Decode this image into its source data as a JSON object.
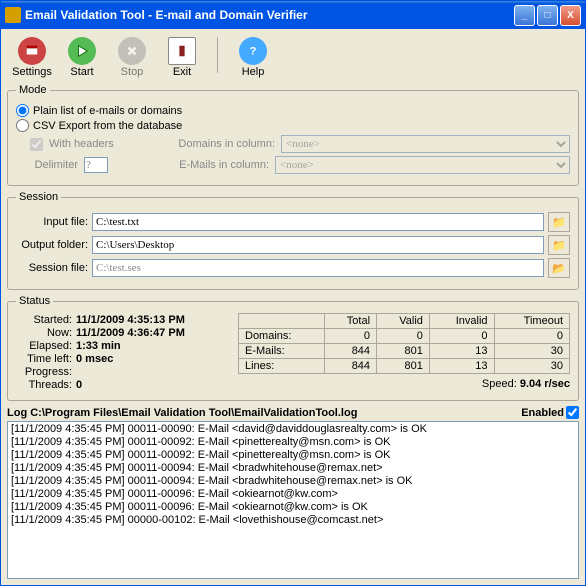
{
  "title": "Email Validation Tool - E-mail and Domain Verifier",
  "toolbar": {
    "settings": "Settings",
    "start": "Start",
    "stop": "Stop",
    "exit": "Exit",
    "help": "Help"
  },
  "mode": {
    "legend": "Mode",
    "opt_plain": "Plain list of e-mails or domains",
    "opt_csv": "CSV Export from the database",
    "with_headers": "With headers",
    "delimiter_lbl": "Delimiter",
    "delimiter_val": "?",
    "dom_col_lbl": "Domains in column:",
    "email_col_lbl": "E-Mails in column:",
    "none": "<none>"
  },
  "session": {
    "legend": "Session",
    "input_lbl": "Input file:",
    "input_val": "C:\\test.txt",
    "output_lbl": "Output folder:",
    "output_val": "C:\\Users\\Desktop",
    "sess_lbl": "Session file:",
    "sess_val": "C:\\test.ses"
  },
  "status": {
    "legend": "Status",
    "started_lbl": "Started:",
    "started_val": "11/1/2009 4:35:13 PM",
    "now_lbl": "Now:",
    "now_val": "11/1/2009 4:36:47 PM",
    "elapsed_lbl": "Elapsed:",
    "elapsed_val": "1:33 min",
    "timeleft_lbl": "Time left:",
    "timeleft_val": "0 msec",
    "progress_lbl": "Progress:",
    "progress_val": "",
    "threads_lbl": "Threads:",
    "threads_val": "0",
    "hdr_total": "Total",
    "hdr_valid": "Valid",
    "hdr_invalid": "Invalid",
    "hdr_timeout": "Timeout",
    "row_domains": "Domains:",
    "row_emails": "E-Mails:",
    "row_lines": "Lines:",
    "d_total": "0",
    "d_valid": "0",
    "d_invalid": "0",
    "d_timeout": "0",
    "e_total": "844",
    "e_valid": "801",
    "e_invalid": "13",
    "e_timeout": "30",
    "l_total": "844",
    "l_valid": "801",
    "l_invalid": "13",
    "l_timeout": "30",
    "speed_lbl": "Speed:",
    "speed_val": "9.04 r/sec"
  },
  "log": {
    "header": "Log C:\\Program Files\\Email Validation Tool\\EmailValidationTool.log",
    "enabled": "Enabled",
    "lines": [
      "[11/1/2009 4:35:45 PM] 00011-00090: E-Mail <david@daviddouglasrealty.com> is OK",
      "[11/1/2009 4:35:45 PM] 00011-00092: E-Mail <pinetterealty@msn.com> is OK",
      "[11/1/2009 4:35:45 PM] 00011-00092: E-Mail <pinetterealty@msn.com> is OK",
      "[11/1/2009 4:35:45 PM] 00011-00094: E-Mail <bradwhitehouse@remax.net>",
      "[11/1/2009 4:35:45 PM] 00011-00094: E-Mail <bradwhitehouse@remax.net> is OK",
      "[11/1/2009 4:35:45 PM] 00011-00096: E-Mail <okiearnot@kw.com>",
      "[11/1/2009 4:35:45 PM] 00011-00096: E-Mail <okiearnot@kw.com> is OK",
      "[11/1/2009 4:35:45 PM] 00000-00102: E-Mail <lovethishouse@comcast.net>"
    ]
  }
}
